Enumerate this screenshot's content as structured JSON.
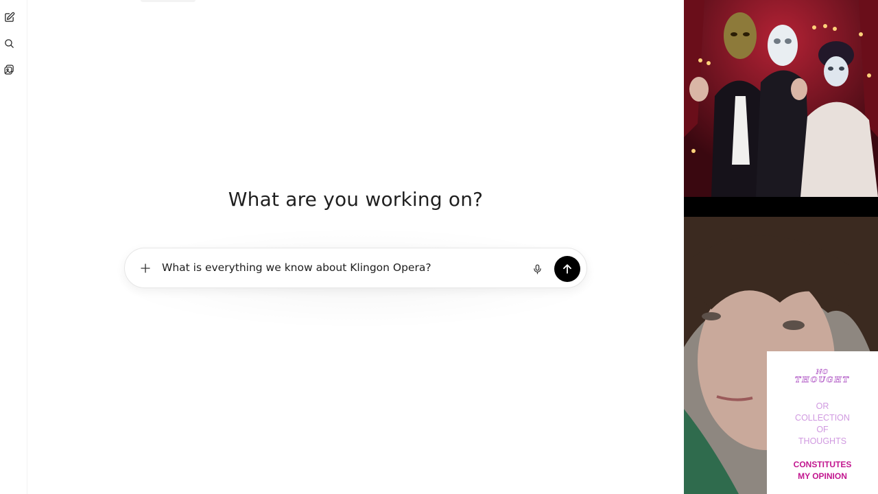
{
  "rail": {
    "icons": [
      "compose-icon",
      "search-icon",
      "library-icon"
    ]
  },
  "main": {
    "heading": "What are you working on?"
  },
  "composer": {
    "prompt_text": "What is everything we know about Klingon Opera?",
    "icons": {
      "add": "plus-icon",
      "voice": "microphone-icon",
      "send": "arrow-up-icon"
    },
    "send_button_color": "#000000"
  },
  "media": {
    "top_image": "masked opera performers image",
    "webcam": "presenter webcam feed",
    "note_card": {
      "line1": "NO",
      "line2": "THOUGHT",
      "line3": "OR",
      "line4": "COLLECTION",
      "line5": "OF",
      "line6": "THOUGHTS",
      "line7": "CONSTITUTES",
      "line8": "MY OPINION",
      "colors": {
        "soft": "#d099e0",
        "strong": "#c2168f"
      }
    }
  }
}
